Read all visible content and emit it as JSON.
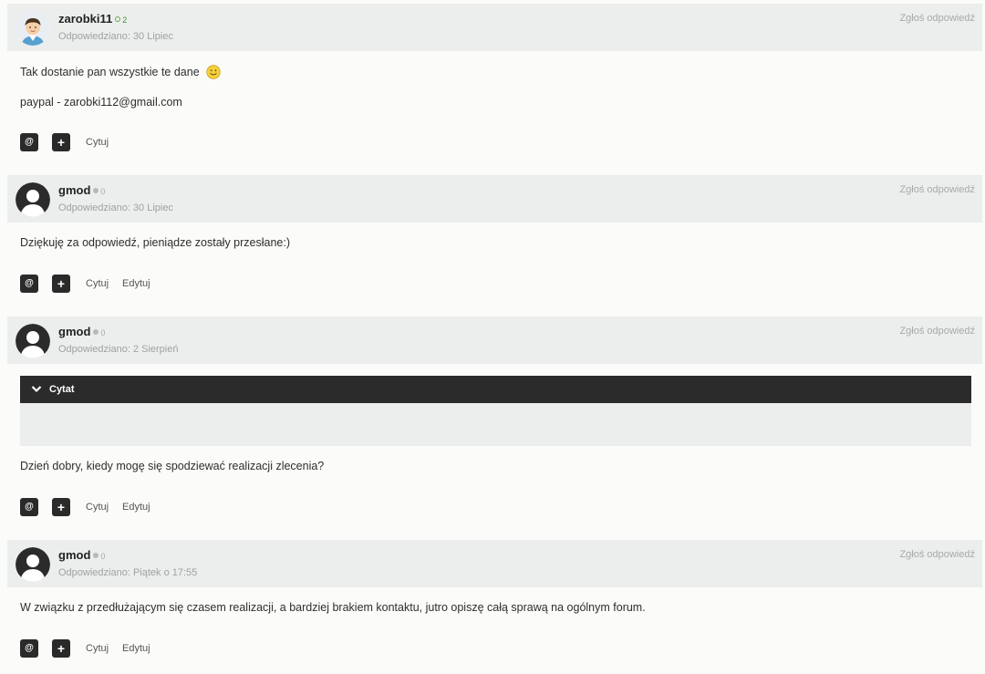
{
  "posts": [
    {
      "author": "zarobki11",
      "rep": "2",
      "date": "Odpowiedziano: 30 Lipiec",
      "report": "Zgłoś odpowiedź",
      "lines": [
        "Tak dostanie pan wszystkie te dane",
        "paypal - zarobki112@gmail.com"
      ],
      "actions": {
        "mention_icon": "@",
        "plus_icon": "+",
        "quote": "Cytuj"
      }
    },
    {
      "author": "gmod",
      "rep": "0",
      "date": "Odpowiedziano: 30 Lipiec",
      "report": "Zgłoś odpowiedź",
      "lines": [
        "Dziękuję za odpowiedź, pieniądze zostały przesłane:)"
      ],
      "actions": {
        "mention_icon": "@",
        "plus_icon": "+",
        "quote": "Cytuj",
        "edit": "Edytuj"
      }
    },
    {
      "author": "gmod",
      "rep": "0",
      "date": "Odpowiedziano: 2 Sierpień",
      "report": "Zgłoś odpowiedź",
      "quote_title": "Cytat",
      "lines": [
        "Dzień dobry, kiedy mogę się spodziewać realizacji zlecenia?"
      ],
      "actions": {
        "mention_icon": "@",
        "plus_icon": "+",
        "quote": "Cytuj",
        "edit": "Edytuj"
      }
    },
    {
      "author": "gmod",
      "rep": "0",
      "date": "Odpowiedziano: Piątek o 17:55",
      "report": "Zgłoś odpowiedź",
      "lines": [
        "W związku z przedłużającym się czasem realizacji, a bardziej brakiem kontaktu, jutro opiszę całą sprawą na ogólnym forum."
      ],
      "actions": {
        "mention_icon": "@",
        "plus_icon": "+",
        "quote": "Cytuj",
        "edit": "Edytuj"
      }
    }
  ],
  "colors": {
    "header_bg": "#eceeee",
    "button_bg": "#2a2a2a",
    "positive_rep": "#4a8a3a"
  },
  "icons": {
    "avatar_custom": "cartoon-person-avatar",
    "avatar_default": "default-user-silhouette",
    "smiley": "smiley-emoji",
    "chevron": "chevron-down-icon"
  }
}
